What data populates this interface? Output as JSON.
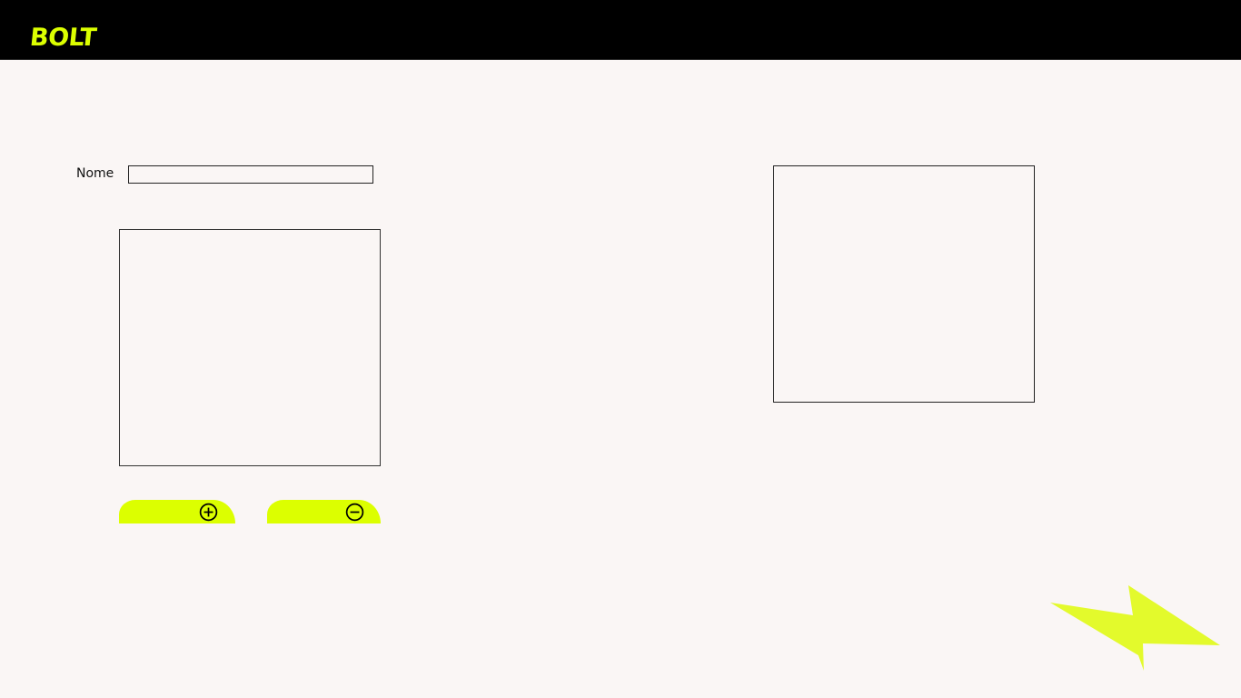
{
  "header": {
    "logo_text": "BOLT",
    "background_color": "#000000",
    "brand_color": "#dcff00"
  },
  "form": {
    "name_label": "Nome",
    "name_value": "",
    "name_placeholder": ""
  },
  "buttons": {
    "add": {
      "icon": "plus-circle-icon",
      "color": "#dcff00"
    },
    "remove": {
      "icon": "minus-circle-icon",
      "color": "#dcff00"
    }
  },
  "decoration": {
    "icon": "lightning-bolt-icon",
    "color": "#e3fa2c"
  },
  "page": {
    "background_color": "#faf6f5"
  }
}
